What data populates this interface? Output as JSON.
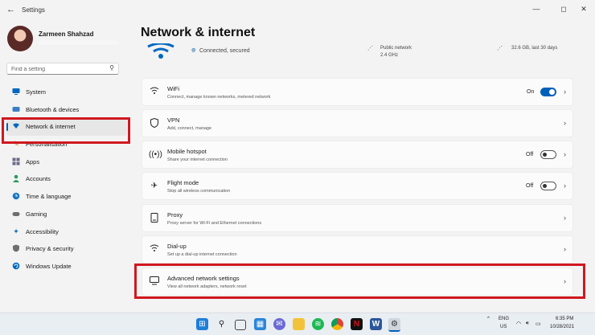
{
  "window": {
    "back_icon": "back-arrow-icon",
    "title": "Settings",
    "minimize": "—",
    "maximize": "◻",
    "close": "✕"
  },
  "profile": {
    "name": "Zarmeen Shahzad"
  },
  "search": {
    "placeholder": "Find a setting",
    "icon": "search-icon"
  },
  "nav": {
    "items": [
      {
        "label": "System",
        "icon": "monitor-icon",
        "color": "#0067c0"
      },
      {
        "label": "Bluetooth & devices",
        "icon": "bluetooth-icon",
        "color": "#0067c0"
      },
      {
        "label": "Network & internet",
        "icon": "wifi-icon",
        "color": "#0067c0",
        "active": true
      },
      {
        "label": "Personalisation",
        "icon": "brush-icon",
        "color": "#d07a2c"
      },
      {
        "label": "Apps",
        "icon": "apps-icon",
        "color": "#6b6b8a"
      },
      {
        "label": "Accounts",
        "icon": "person-icon",
        "color": "#2a9d5a"
      },
      {
        "label": "Time & language",
        "icon": "globe-clock-icon",
        "color": "#1a78c2"
      },
      {
        "label": "Gaming",
        "icon": "gamepad-icon",
        "color": "#6e6e6e"
      },
      {
        "label": "Accessibility",
        "icon": "accessibility-icon",
        "color": "#1a6fb0"
      },
      {
        "label": "Privacy & security",
        "icon": "shield-icon",
        "color": "#6e6e6e"
      },
      {
        "label": "Windows Update",
        "icon": "update-icon",
        "color": "#0067c0"
      }
    ]
  },
  "main": {
    "title": "Network & internet",
    "status": {
      "text": "Connected, secured",
      "network_type": "Public network",
      "band": "2.4 GHz",
      "data_usage": "32.6 GB, last 30 days"
    },
    "cards": [
      {
        "title": "WiFi",
        "subtitle": "Connect, manage known networks, metered network",
        "icon": "wifi-icon",
        "state": "On",
        "toggle": "on"
      },
      {
        "title": "VPN",
        "subtitle": "Add, connect, manage",
        "icon": "vpn-shield-icon"
      },
      {
        "title": "Mobile hotspot",
        "subtitle": "Share your internet connection",
        "icon": "hotspot-icon",
        "state": "Off",
        "toggle": "off"
      },
      {
        "title": "Flight mode",
        "subtitle": "Stop all wireless communication",
        "icon": "airplane-icon",
        "state": "Off",
        "toggle": "off"
      },
      {
        "title": "Proxy",
        "subtitle": "Proxy server for Wi-Fi and Ethernet connections",
        "icon": "proxy-icon"
      },
      {
        "title": "Dial-up",
        "subtitle": "Set up a dial-up internet connection",
        "icon": "dialup-icon"
      },
      {
        "title": "Advanced network settings",
        "subtitle": "View all network adapters, network reset",
        "icon": "network-adapter-icon"
      }
    ]
  },
  "taskbar": {
    "apps": [
      "windows-start-icon",
      "search-icon",
      "task-view-icon",
      "widgets-icon",
      "chat-icon",
      "file-explorer-icon",
      "spotify-icon",
      "chrome-icon",
      "netflix-icon",
      "word-icon",
      "settings-icon"
    ],
    "tray": {
      "language": "ENG",
      "region": "US",
      "time": "6:35 PM",
      "date": "10/28/2021"
    }
  },
  "colors": {
    "accent": "#005fb8",
    "highlight_box": "#d01820"
  }
}
